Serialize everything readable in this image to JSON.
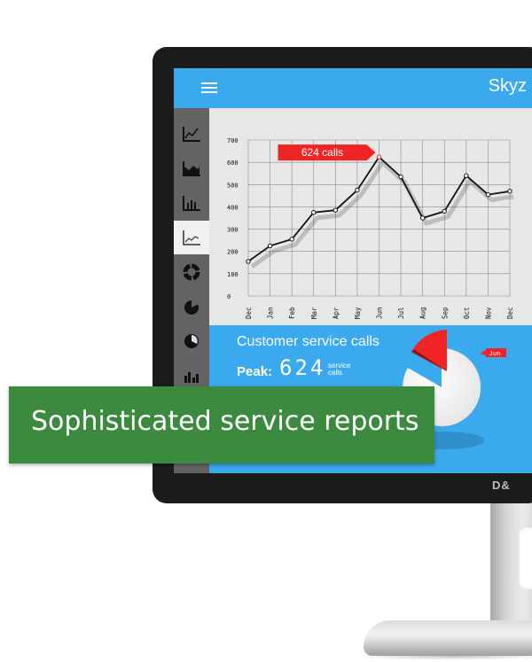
{
  "app": {
    "brand": "Skyz"
  },
  "sidebar": {
    "items": [
      {
        "icon": "line-chart-icon",
        "active": false
      },
      {
        "icon": "area-chart-icon",
        "active": false
      },
      {
        "icon": "bar-chart-icon",
        "active": false
      },
      {
        "icon": "line-chart-icon",
        "active": true
      },
      {
        "icon": "donut-chart-icon",
        "active": false
      },
      {
        "icon": "pie-chart-icon",
        "active": false
      },
      {
        "icon": "pie-chart-icon",
        "active": false
      },
      {
        "icon": "bar-chart-icon",
        "active": false
      }
    ]
  },
  "panel": {
    "title": "Customer service calls",
    "peak_label": "Peak:",
    "peak_value": "624",
    "peak_unit_line1": "service",
    "peak_unit_line2": "calls",
    "pie_tag": "Jun"
  },
  "banner": {
    "text": "Sophisticated service reports"
  },
  "monitor": {
    "logo": "D&"
  },
  "colors": {
    "accent": "#3aa9ee",
    "highlight": "#ef2424",
    "banner": "#3c8a3f"
  },
  "chart_data": {
    "type": "line",
    "categories": [
      "Dec",
      "Jan",
      "Feb",
      "Mar",
      "Apr",
      "May",
      "Jun",
      "Jul",
      "Aug",
      "Sep",
      "Oct",
      "Nov",
      "Dec"
    ],
    "values": [
      155,
      225,
      255,
      375,
      385,
      475,
      624,
      535,
      350,
      380,
      540,
      455,
      470
    ],
    "ylim": [
      0,
      700
    ],
    "yticks": [
      0,
      100,
      200,
      300,
      400,
      500,
      600,
      700
    ],
    "grid": true,
    "annotation": {
      "text": "624 calls",
      "category_index": 6
    }
  }
}
